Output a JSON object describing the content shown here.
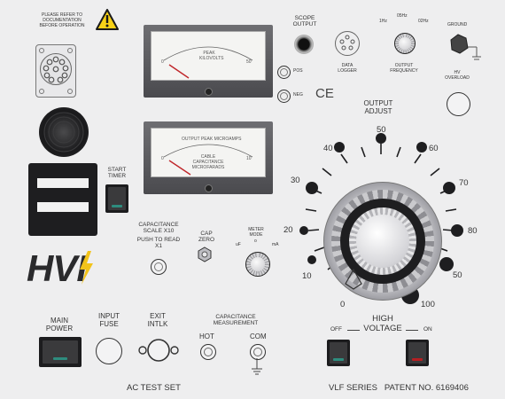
{
  "warning_text": "PLEASE REFER TO\nDOCUMENTATION\nBEFORE OPERATION",
  "scope_output": "SCOPE\nOUTPUT",
  "ground": "GROUND",
  "meter1": {
    "title": "PEAK\nKILOVOLTS",
    "scale_left": "0",
    "scale_right": "50"
  },
  "pos": "POS",
  "neg": "NEG",
  "data_logger": "DATA\nLOGGER",
  "output_frequency": {
    "label": "OUTPUT\nFREQUENCY",
    "low": "1Hz",
    "mid": "05Hz",
    "high": "02Hz"
  },
  "hv_overload": "HV\nOVERLOAD",
  "ce_mark": "CE",
  "output_adjust": "OUTPUT\nADJUST",
  "meter2": {
    "title": "OUTPUT PEAK MICROAMPS",
    "subtitle": "CABLE CAPACITANCE\nMICROFARADS",
    "scale_left": "0",
    "scale_right": "10"
  },
  "start_timer": "START\nTIMER",
  "capacitance_scale": "CAPACITANCE\nSCALE X10",
  "push_to_read": "PUSH TO READ\nX1",
  "cap_zero": "CAP\nZERO",
  "meter_mode": {
    "label": "METER\nMODE",
    "left": "uF",
    "mid": "o",
    "right": "mA"
  },
  "dial_ticks": [
    "0",
    "10",
    "20",
    "30",
    "40",
    "50",
    "60",
    "70",
    "80",
    "50",
    "100"
  ],
  "logo": "HVI",
  "main_power": "MAIN\nPOWER",
  "input_fuse": "INPUT\nFUSE",
  "exit_intlk": "EXIT\nINTLK",
  "capacitance_measurement": "CAPACITANCE\nMEASUREMENT",
  "hot": "HOT",
  "com": "COM",
  "high_voltage": "HIGH\nVOLTAGE",
  "off": "OFF",
  "on": "ON",
  "footer_left": "AC TEST SET",
  "footer_right": "VLF SERIES   PATENT NO. 6169406",
  "colors": {
    "panel": "#eeeeef",
    "led_green": "#2e8c7e",
    "led_red": "#b51f22",
    "warning_yellow": "#f7d117",
    "dial_knob": "#1e1e20"
  }
}
